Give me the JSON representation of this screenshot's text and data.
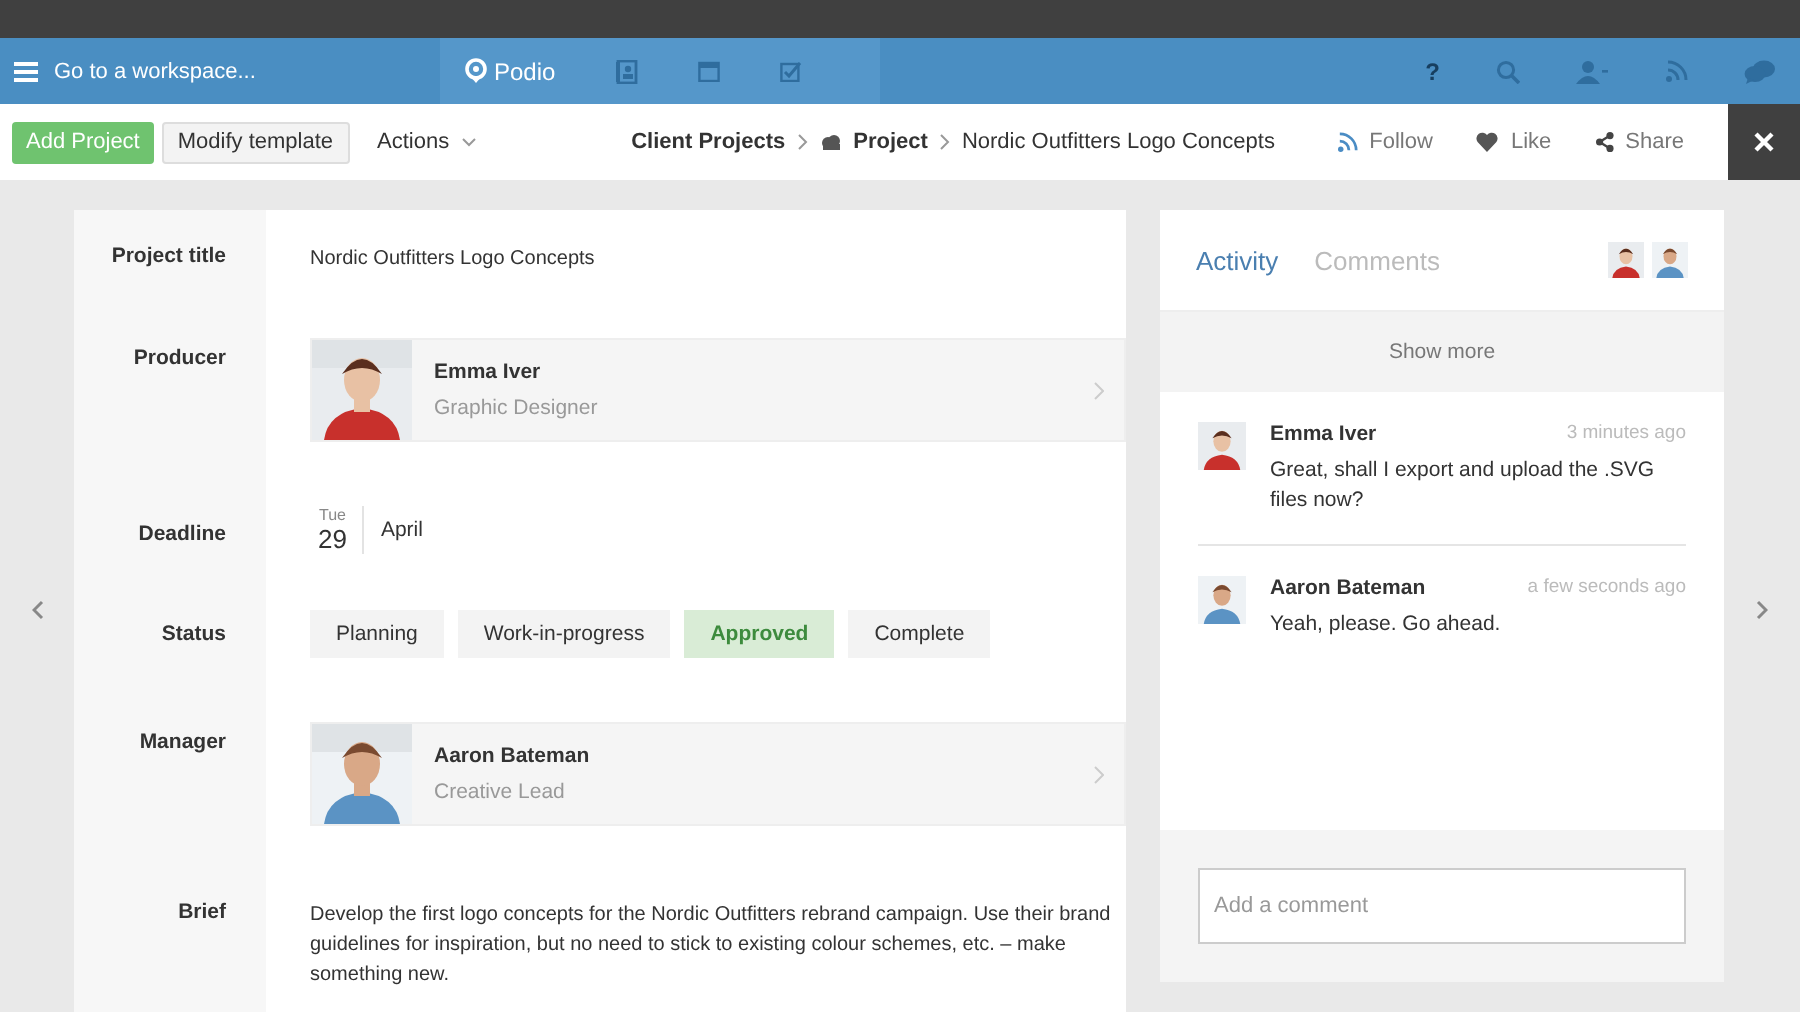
{
  "top_nav": {
    "workspace_label": "Go to a workspace...",
    "brand": "Podio",
    "help": "?"
  },
  "toolbar": {
    "add_button": "Add Project",
    "modify_button": "Modify template",
    "actions": "Actions",
    "breadcrumb": [
      "Client Projects",
      "Project",
      "Nordic Outfitters Logo Concepts"
    ],
    "follow": "Follow",
    "like": "Like",
    "share": "Share"
  },
  "fields": [
    {
      "label": "Project title",
      "kind": "text",
      "value": "Nordic Outfitters Logo Concepts"
    },
    {
      "label": "Producer",
      "kind": "contact",
      "name": "Emma Iver",
      "role": "Graphic Designer"
    },
    {
      "label": "Deadline",
      "kind": "date",
      "weekday": "Tue",
      "day": "29",
      "month": "April"
    },
    {
      "label": "Status",
      "kind": "options",
      "options": [
        {
          "label": "Planning",
          "selected": false
        },
        {
          "label": "Work-in-progress",
          "selected": false
        },
        {
          "label": "Approved",
          "selected": true
        },
        {
          "label": "Complete",
          "selected": false
        }
      ]
    },
    {
      "label": "Manager",
      "kind": "contact",
      "name": "Aaron Bateman",
      "role": "Creative Lead"
    },
    {
      "label": "Brief",
      "kind": "text",
      "value": "Develop the first logo concepts for the Nordic Outfitters rebrand campaign. Use their brand guidelines for inspiration, but no need to stick to existing colour schemes, etc. – make something new."
    }
  ],
  "activity": {
    "tabs": [
      {
        "label": "Activity",
        "selected": true
      },
      {
        "label": "Comments",
        "selected": false
      }
    ],
    "show_more": "Show more",
    "entries": [
      {
        "name": "Emma Iver",
        "time": "3 minutes ago",
        "text": "Great, shall I export and upload the .SVG files now?"
      },
      {
        "name": "Aaron Bateman",
        "time": "a few seconds ago",
        "text": "Yeah, please. Go ahead."
      }
    ],
    "comment_box": {
      "placeholder": "Add a comment"
    }
  }
}
